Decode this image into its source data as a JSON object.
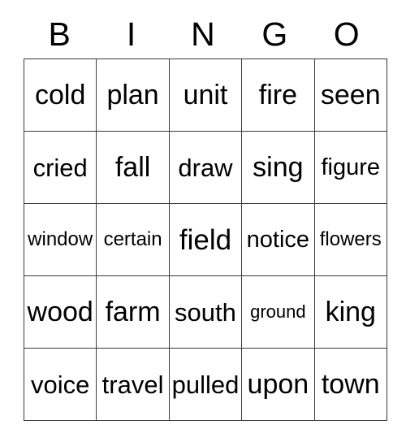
{
  "card": {
    "header": {
      "letters": [
        "B",
        "I",
        "N",
        "G",
        "O"
      ]
    },
    "grid": {
      "columns": 5,
      "rows": 5,
      "cells": [
        [
          {
            "word": "cold",
            "size": "lg"
          },
          {
            "word": "plan",
            "size": "lg"
          },
          {
            "word": "unit",
            "size": "lg"
          },
          {
            "word": "fire",
            "size": "lg"
          },
          {
            "word": "seen",
            "size": "lg"
          }
        ],
        [
          {
            "word": "cried",
            "size": "md"
          },
          {
            "word": "fall",
            "size": "lg"
          },
          {
            "word": "draw",
            "size": "md"
          },
          {
            "word": "sing",
            "size": "lg"
          },
          {
            "word": "figure",
            "size": "sm"
          }
        ],
        [
          {
            "word": "window",
            "size": "xs"
          },
          {
            "word": "certain",
            "size": "xs"
          },
          {
            "word": "field",
            "size": "xl"
          },
          {
            "word": "notice",
            "size": "sm"
          },
          {
            "word": "flowers",
            "size": "xs"
          }
        ],
        [
          {
            "word": "wood",
            "size": "lg"
          },
          {
            "word": "farm",
            "size": "lg"
          },
          {
            "word": "south",
            "size": "md"
          },
          {
            "word": "ground",
            "size": "xxs"
          },
          {
            "word": "king",
            "size": "lg"
          }
        ],
        [
          {
            "word": "voice",
            "size": "md"
          },
          {
            "word": "travel",
            "size": "md"
          },
          {
            "word": "pulled",
            "size": "md"
          },
          {
            "word": "upon",
            "size": "lg"
          },
          {
            "word": "town",
            "size": "lg"
          }
        ]
      ]
    },
    "colors": {
      "background": "#ffffff",
      "text": "#000000",
      "border": "#3a3a3a"
    }
  }
}
